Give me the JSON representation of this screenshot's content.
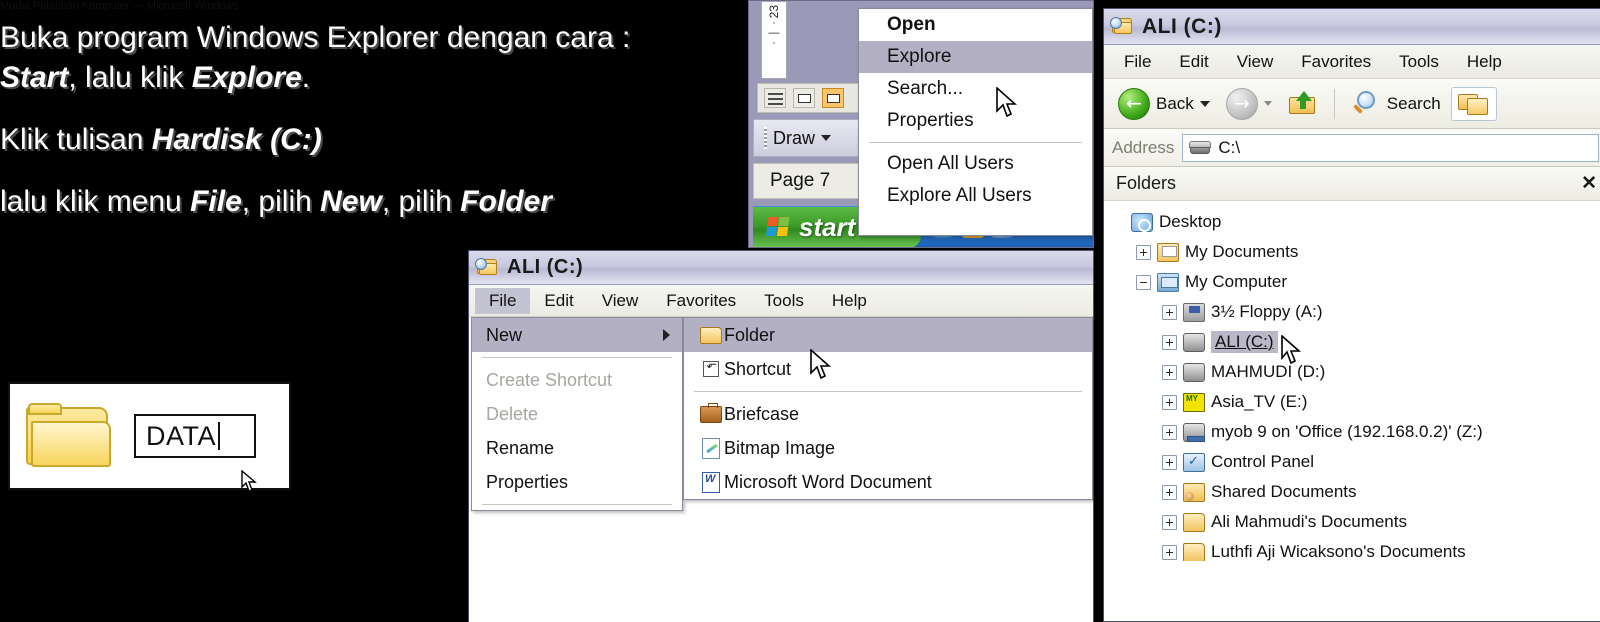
{
  "slide": {
    "cutoff_top_text": "Modul Pelatihan Komputer — Microsoft Windows",
    "instructions": [
      {
        "segments": [
          {
            "text": "Buka program Windows Explorer dengan cara : ",
            "italic": false
          },
          {
            "text": "",
            "italic": false
          }
        ]
      },
      {
        "segments": [
          {
            "text": "Start",
            "italic": true
          },
          {
            "text": ", lalu klik ",
            "italic": false
          },
          {
            "text": "Explore",
            "italic": true
          },
          {
            "text": ".",
            "italic": false
          }
        ]
      },
      {
        "segments": [
          {
            "text": "Klik tulisan ",
            "italic": false
          },
          {
            "text": "Hardisk (C:)",
            "italic": true
          }
        ]
      },
      {
        "segments": [
          {
            "text": "lalu klik menu ",
            "italic": false
          },
          {
            "text": "File",
            "italic": true
          },
          {
            "text": ", pilih ",
            "italic": false
          },
          {
            "text": "New",
            "italic": true
          },
          {
            "text": ", pilih ",
            "italic": false
          },
          {
            "text": "Folder",
            "italic": true
          }
        ]
      }
    ]
  },
  "start_context_menu": {
    "items": [
      {
        "label": "Open",
        "bold": true,
        "highlighted": false
      },
      {
        "label": "Explore",
        "bold": false,
        "highlighted": true
      },
      {
        "label": "Search...",
        "bold": false,
        "highlighted": false
      },
      {
        "label": "Properties",
        "bold": false,
        "highlighted": false
      },
      {
        "separator": true
      },
      {
        "label": "Open All Users",
        "bold": false,
        "highlighted": false
      },
      {
        "label": "Explore All Users",
        "bold": false,
        "highlighted": false
      }
    ]
  },
  "background_app": {
    "ruler_number": "23",
    "ruler_ticks": [
      "·",
      "—",
      "·"
    ],
    "draw_label": "Draw",
    "status_label": "Page  7",
    "start_button_label": "start"
  },
  "explorer2": {
    "title": "ALI (C:)",
    "menubar": [
      "File",
      "Edit",
      "View",
      "Favorites",
      "Tools",
      "Help"
    ],
    "active_menu": "File",
    "file_menu": [
      {
        "label": "New",
        "highlighted": true,
        "disabled": false,
        "submenu": true
      },
      {
        "separator": true
      },
      {
        "label": "Create Shortcut",
        "highlighted": false,
        "disabled": true
      },
      {
        "label": "Delete",
        "highlighted": false,
        "disabled": true
      },
      {
        "label": "Rename",
        "highlighted": false,
        "disabled": false
      },
      {
        "label": "Properties",
        "highlighted": false,
        "disabled": false
      }
    ],
    "new_submenu": [
      {
        "label": "Folder",
        "icon": "folder-icon",
        "highlighted": true
      },
      {
        "label": "Shortcut",
        "icon": "shortcut-icon",
        "highlighted": false
      },
      {
        "separator": true
      },
      {
        "label": "Briefcase",
        "icon": "briefcase-icon",
        "highlighted": false
      },
      {
        "label": "Bitmap Image",
        "icon": "bitmap-image-icon",
        "highlighted": false
      },
      {
        "label": "Microsoft Word Document",
        "icon": "word-document-icon",
        "highlighted": false
      }
    ]
  },
  "explorer": {
    "title": "ALI (C:)",
    "menubar": [
      "File",
      "Edit",
      "View",
      "Favorites",
      "Tools",
      "Help"
    ],
    "toolbar": {
      "back_label": "Back",
      "forward_label": "",
      "up_label": "",
      "search_label": "Search",
      "folders_label": ""
    },
    "address": {
      "label": "Address",
      "value": "C:\\"
    },
    "folders_pane": {
      "title": "Folders",
      "close_label": "✕",
      "tree": [
        {
          "label": "Desktop",
          "icon": "desktop-icon",
          "expander": "none",
          "level": 0,
          "selected": false
        },
        {
          "label": "My Documents",
          "icon": "my-documents-icon",
          "expander": "plus",
          "level": 1,
          "selected": false
        },
        {
          "label": "My Computer",
          "icon": "my-computer-icon",
          "expander": "minus",
          "level": 1,
          "selected": false
        },
        {
          "label": "3½ Floppy (A:)",
          "icon": "floppy-drive-icon",
          "expander": "plus",
          "level": 2,
          "selected": false
        },
        {
          "label": "ALI (C:)",
          "icon": "hard-drive-icon",
          "expander": "plus",
          "level": 2,
          "selected": true
        },
        {
          "label": "MAHMUDI (D:)",
          "icon": "hard-drive-icon",
          "expander": "plus",
          "level": 2,
          "selected": false
        },
        {
          "label": "Asia_TV (E:)",
          "icon": "myob-drive-icon",
          "expander": "plus",
          "level": 2,
          "selected": false
        },
        {
          "label": "myob 9 on 'Office (192.168.0.2)' (Z:)",
          "icon": "network-drive-icon",
          "expander": "plus",
          "level": 2,
          "selected": false
        },
        {
          "label": "Control Panel",
          "icon": "control-panel-icon",
          "expander": "plus",
          "level": 2,
          "selected": false
        },
        {
          "label": "Shared Documents",
          "icon": "shared-documents-icon",
          "expander": "plus",
          "level": 2,
          "selected": false
        },
        {
          "label": "Ali Mahmudi's Documents",
          "icon": "folder-icon",
          "expander": "plus",
          "level": 2,
          "selected": false
        },
        {
          "label": "Luthfi Aji Wicaksono's Documents",
          "icon": "folder-icon",
          "expander": "plus",
          "level": 2,
          "selected": false
        }
      ]
    }
  },
  "data_callout": {
    "folder_icon": "folder-icon",
    "rename_value": "DATA"
  },
  "colors": {
    "background": "#000000",
    "menu_highlight": "#b4b0c4",
    "tree_selection": "#b8b8c8",
    "start_green": "#3d9b28",
    "folder_yellow": "#f2c45f"
  }
}
